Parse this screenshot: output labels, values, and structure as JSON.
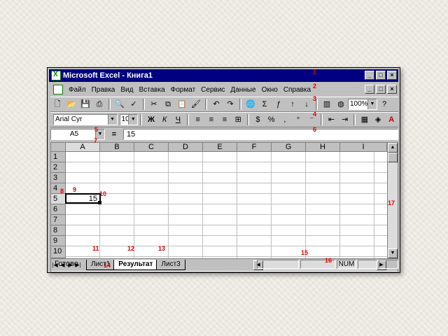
{
  "window": {
    "title": "Microsoft Excel - Книга1",
    "min": "_",
    "max": "□",
    "close": "×"
  },
  "menu": {
    "items": [
      "Файл",
      "Правка",
      "Вид",
      "Вставка",
      "Формат",
      "Сервис",
      "Данные",
      "Окно",
      "Справка"
    ]
  },
  "toolbar": {
    "zoom": "100%"
  },
  "format_toolbar": {
    "font": "Arial Cyr",
    "size": "10",
    "bold": "Ж",
    "italic": "К",
    "underline": "Ч"
  },
  "formula_bar": {
    "name_box": "A5",
    "equals": "=",
    "value": "15"
  },
  "grid": {
    "columns": [
      "A",
      "B",
      "C",
      "D",
      "E",
      "F",
      "G",
      "H",
      "I"
    ],
    "rows": [
      "1",
      "2",
      "3",
      "4",
      "5",
      "6",
      "7",
      "8",
      "9",
      "10"
    ],
    "active_cell_value": "15"
  },
  "sheets": {
    "tabs": [
      "Лист1",
      "Результат",
      "Лист3"
    ],
    "active": "Результат"
  },
  "status": {
    "ready": "Готово",
    "num": "NUM"
  },
  "markers": [
    "1",
    "2",
    "3",
    "4",
    "5",
    "6",
    "7",
    "8",
    "9",
    "10",
    "11",
    "12",
    "13",
    "14",
    "15",
    "16",
    "17"
  ],
  "colors": {
    "title_bar": "#000080",
    "marker": "#e00000"
  }
}
